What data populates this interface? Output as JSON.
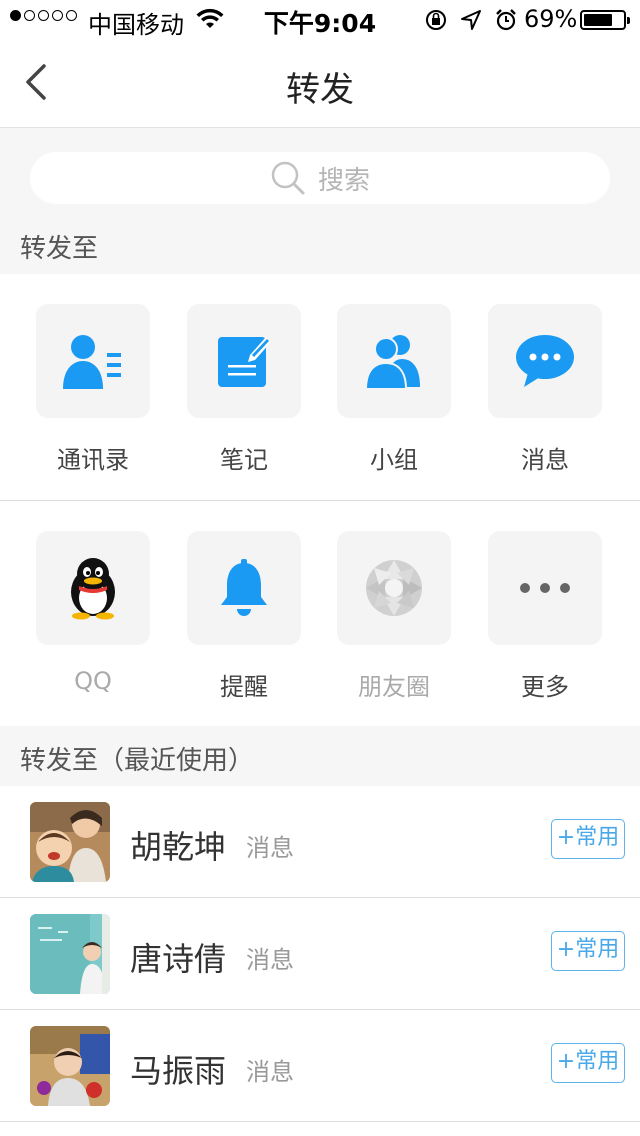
{
  "status_bar": {
    "carrier": "中国移动",
    "time": "下午9:04",
    "battery_percent": "69%",
    "signal_bars": 1
  },
  "nav": {
    "title": "转发",
    "back_icon": "chevron-left-icon"
  },
  "search": {
    "placeholder": "搜索",
    "icon": "search-icon"
  },
  "forward_to_label": "转发至",
  "grid": [
    {
      "label": "通讯录",
      "icon": "contacts-icon",
      "color": "#1a9af2",
      "muted": false
    },
    {
      "label": "笔记",
      "icon": "note-icon",
      "color": "#1a9af2",
      "muted": false
    },
    {
      "label": "小组",
      "icon": "group-icon",
      "color": "#1a9af2",
      "muted": false
    },
    {
      "label": "消息",
      "icon": "message-icon",
      "color": "#1a9af2",
      "muted": false
    },
    {
      "label": "QQ",
      "icon": "qq-penguin-icon",
      "color": "#000000",
      "muted": true
    },
    {
      "label": "提醒",
      "icon": "bell-icon",
      "color": "#1a9af2",
      "muted": false
    },
    {
      "label": "朋友圈",
      "icon": "moments-shutter-icon",
      "color": "#c8c8c8",
      "muted": true
    },
    {
      "label": "更多",
      "icon": "more-dots-icon",
      "color": "#555555",
      "muted": false
    }
  ],
  "recent_label": "转发至（最近使用）",
  "contacts": [
    {
      "name": "胡乾坤",
      "type": "消息",
      "action": "+常用"
    },
    {
      "name": "唐诗倩",
      "type": "消息",
      "action": "+常用"
    },
    {
      "name": "马振雨",
      "type": "消息",
      "action": "+常用"
    }
  ],
  "colors": {
    "accent": "#1a9af2",
    "background_gray": "#f6f6f6",
    "fav_button": "#4aa8e8"
  }
}
